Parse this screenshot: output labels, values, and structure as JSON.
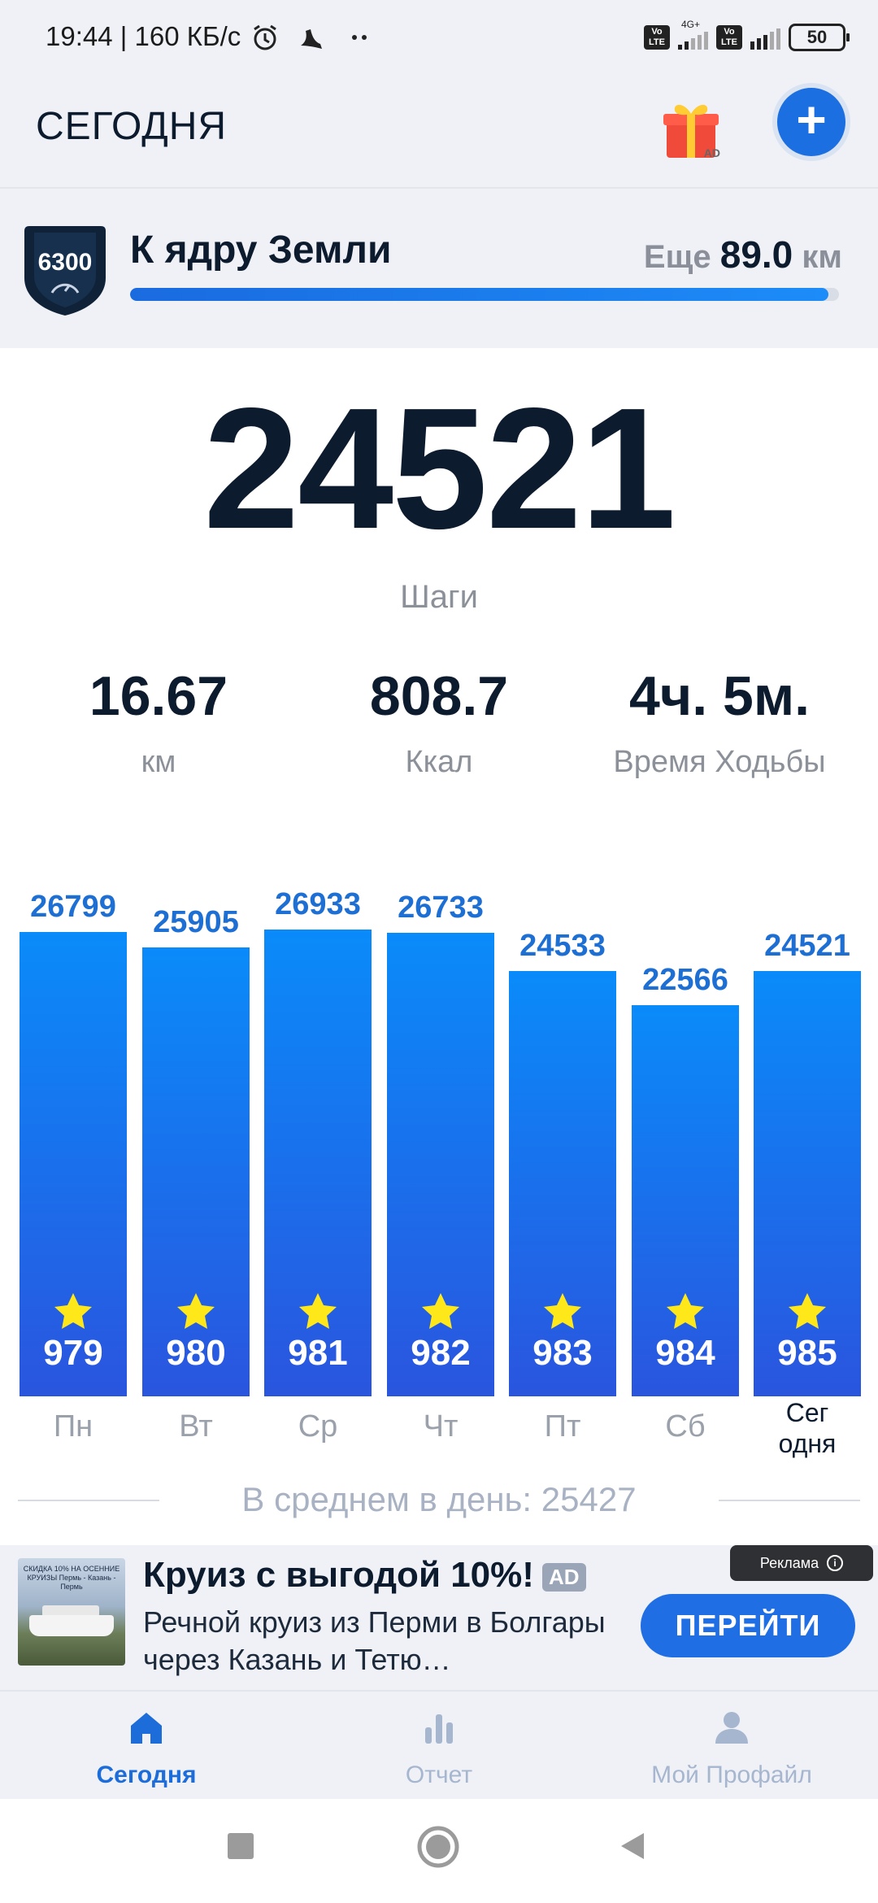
{
  "status_bar": {
    "time_speed": "19:44 | 160 КБ/с",
    "network": "4G+",
    "battery": "50"
  },
  "header": {
    "title": "СЕГОДНЯ",
    "gift_ad_label": "AD"
  },
  "challenge": {
    "badge_number": "6300",
    "name": "К ядру Земли",
    "remaining_prefix": "Еще",
    "remaining_value": "89.0",
    "remaining_unit": "км",
    "progress_fraction": 0.985
  },
  "today": {
    "steps": "24521",
    "steps_label": "Шаги",
    "stats": [
      {
        "value": "16.67",
        "label": "км"
      },
      {
        "value": "808.7",
        "label": "Ккал"
      },
      {
        "value": "4ч. 5м.",
        "label": "Время Ходьбы"
      }
    ]
  },
  "chart_data": {
    "type": "bar",
    "categories": [
      "Пн",
      "Вт",
      "Ср",
      "Чт",
      "Пт",
      "Сб",
      "Сег\nодня"
    ],
    "values": [
      26799,
      25905,
      26933,
      26733,
      24533,
      22566,
      24521
    ],
    "value_labels": [
      "26799",
      "25905",
      "26933",
      "26733",
      "24533",
      "22566",
      "24521"
    ],
    "star_counts": [
      "979",
      "980",
      "981",
      "982",
      "983",
      "984",
      "985"
    ],
    "ylim": [
      0,
      26933
    ],
    "grid": false
  },
  "average": {
    "text": "В среднем в день: 25427"
  },
  "ad": {
    "title": "Круиз с выгодой 10%!",
    "tag": "AD",
    "description": "Речной круиз из Перми в Болгары через Казань и Тетю…",
    "label": "Реклама",
    "button": "ПЕРЕЙТИ",
    "thumb_caption": "СКИДКА 10% НА ОСЕННИЕ КРУИЗЫ Пермь - Казань - Пермь"
  },
  "tabs": [
    {
      "label": "Сегодня",
      "active": true
    },
    {
      "label": "Отчет",
      "active": false
    },
    {
      "label": "Мой Профайл",
      "active": false
    }
  ],
  "colors": {
    "accent": "#1c6fe0",
    "bar_top": "#0a8bfa",
    "bar_bottom": "#2a55de",
    "star": "#ffe81a",
    "value_label": "#1e6fd4"
  }
}
